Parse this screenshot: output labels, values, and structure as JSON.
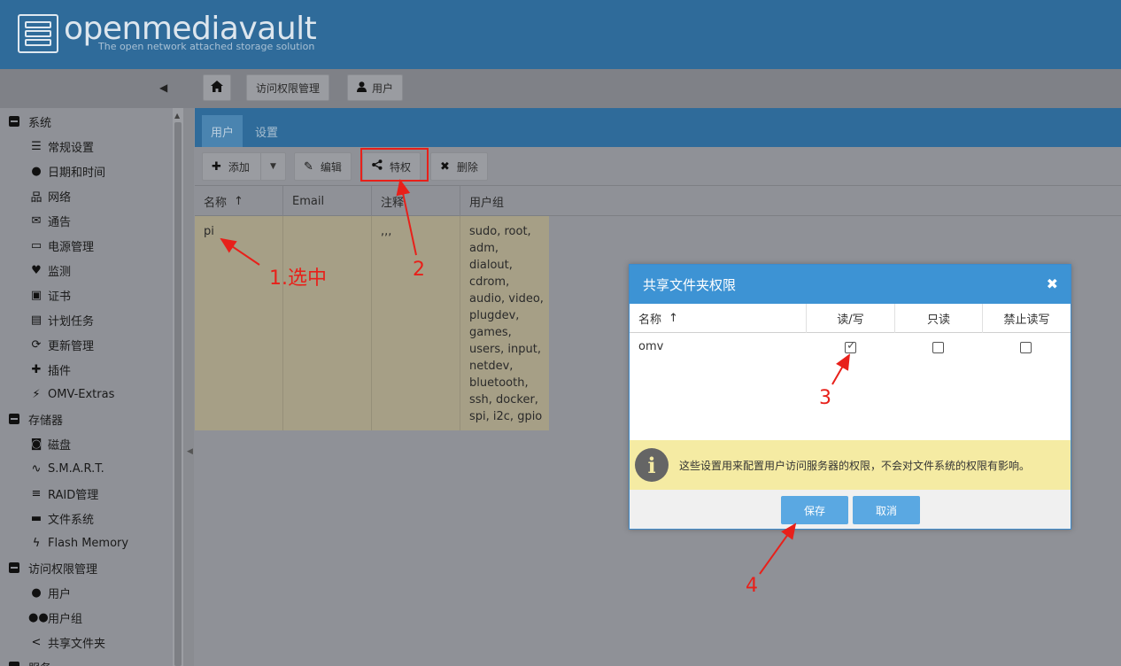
{
  "header": {
    "brand": "openmediavault",
    "tagline": "The open network attached storage solution"
  },
  "breadcrumb": {
    "home_icon": "home-icon",
    "items": [
      "访问权限管理",
      "用户"
    ]
  },
  "sidebar": {
    "groups": [
      {
        "label": "系统",
        "items": [
          {
            "label": "常规设置",
            "icon": "sliders-icon"
          },
          {
            "label": "日期和时间",
            "icon": "clock-icon"
          },
          {
            "label": "网络",
            "icon": "network-icon"
          },
          {
            "label": "通告",
            "icon": "envelope-icon"
          },
          {
            "label": "电源管理",
            "icon": "battery-icon"
          },
          {
            "label": "监测",
            "icon": "heartbeat-icon"
          },
          {
            "label": "证书",
            "icon": "certificate-icon"
          },
          {
            "label": "计划任务",
            "icon": "calendar-clock-icon"
          },
          {
            "label": "更新管理",
            "icon": "refresh-icon"
          },
          {
            "label": "插件",
            "icon": "puzzle-icon"
          },
          {
            "label": "OMV-Extras",
            "icon": "plug-icon"
          }
        ]
      },
      {
        "label": "存储器",
        "items": [
          {
            "label": "磁盘",
            "icon": "hdd-icon"
          },
          {
            "label": "S.M.A.R.T.",
            "icon": "pulse-icon"
          },
          {
            "label": "RAID管理",
            "icon": "database-icon"
          },
          {
            "label": "文件系统",
            "icon": "folder-icon"
          },
          {
            "label": "Flash Memory",
            "icon": "bolt-icon"
          }
        ]
      },
      {
        "label": "访问权限管理",
        "items": [
          {
            "label": "用户",
            "icon": "user-icon"
          },
          {
            "label": "用户组",
            "icon": "users-icon"
          },
          {
            "label": "共享文件夹",
            "icon": "share-icon"
          }
        ]
      },
      {
        "label": "服务",
        "items": []
      }
    ]
  },
  "tabs": [
    "用户",
    "设置"
  ],
  "toolbar": {
    "add": "添加",
    "edit": "编辑",
    "privileges": "特权",
    "delete": "删除"
  },
  "grid": {
    "columns": [
      "名称",
      "Email",
      "注释",
      "用户组"
    ],
    "rows": [
      {
        "name": "pi",
        "email": "",
        "comment": ",,,",
        "groups": [
          "sudo, root,",
          "adm,",
          "dialout,",
          "cdrom,",
          "audio, video,",
          "plugdev,",
          "games,",
          "users, input,",
          "netdev,",
          "bluetooth,",
          "ssh, docker,",
          "spi, i2c, gpio"
        ]
      }
    ]
  },
  "dialog": {
    "title": "共享文件夹权限",
    "columns": [
      "名称",
      "读/写",
      "只读",
      "禁止读写"
    ],
    "rows": [
      {
        "name": "omv",
        "read_write": true,
        "read_only": false,
        "no_access": false
      }
    ],
    "info": "这些设置用来配置用户访问服务器的权限，不会对文件系统的权限有影响。",
    "save": "保存",
    "cancel": "取消"
  },
  "annotations": [
    "1.选中",
    "2",
    "3",
    "4"
  ],
  "colors": {
    "header": "#2f6b9a",
    "dialog_title": "#3d93d4",
    "button": "#5aa8e2",
    "annotation": "#e8201a",
    "selected_row": "#a69f86",
    "info_bg": "#f5eba3"
  }
}
